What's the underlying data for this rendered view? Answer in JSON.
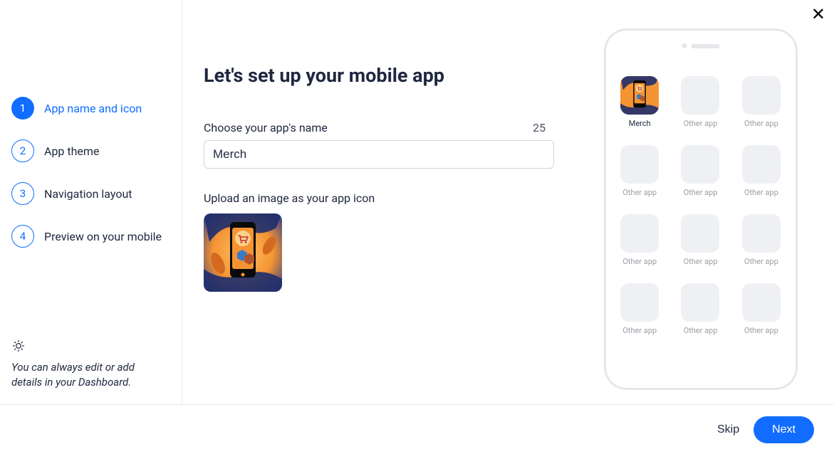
{
  "close_glyph": "✕",
  "sidebar": {
    "steps": [
      {
        "num": "1",
        "label": "App name and icon",
        "state": "active"
      },
      {
        "num": "2",
        "label": "App theme",
        "state": "pending"
      },
      {
        "num": "3",
        "label": "Navigation layout",
        "state": "pending"
      },
      {
        "num": "4",
        "label": "Preview on your mobile",
        "state": "pending"
      }
    ],
    "hint": "You can always edit or add details in your Dashboard."
  },
  "main": {
    "title": "Let's set up your mobile app",
    "name_label": "Choose your app's name",
    "name_counter": "25",
    "name_value": "Merch",
    "upload_label": "Upload an image as your app icon"
  },
  "preview": {
    "main_app_label": "Merch",
    "other_app_label": "Other app"
  },
  "footer": {
    "skip": "Skip",
    "next": "Next"
  },
  "colors": {
    "accent": "#116dff"
  }
}
